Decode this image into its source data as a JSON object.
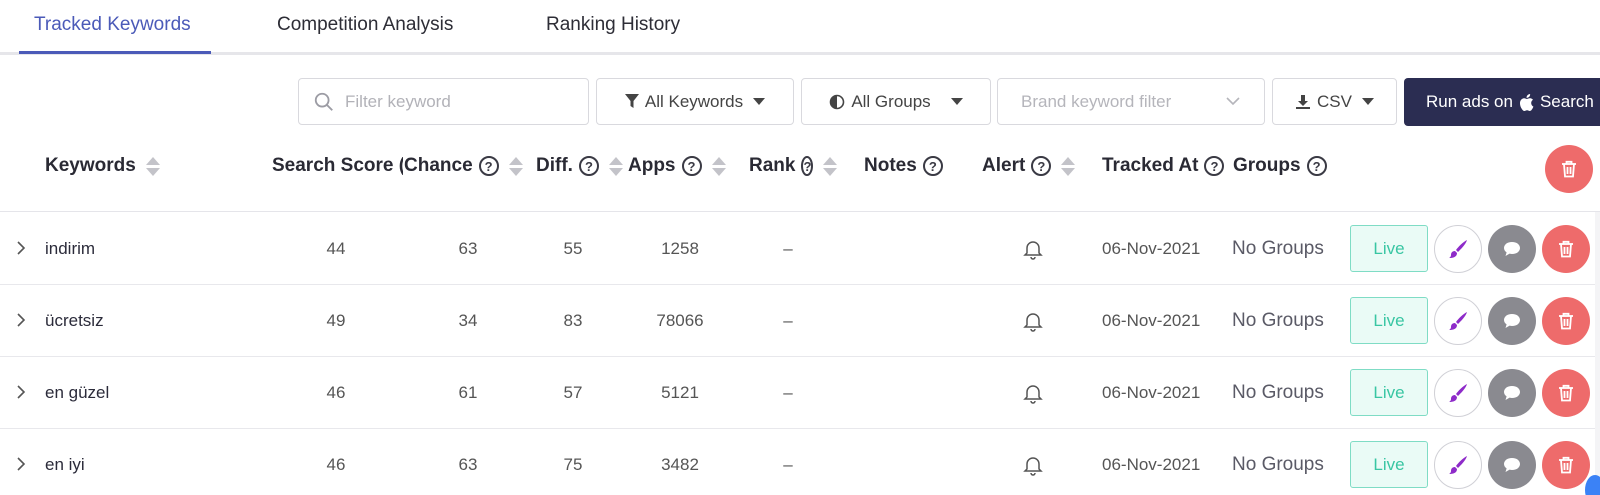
{
  "tabs": [
    {
      "label": "Tracked Keywords",
      "active": true
    },
    {
      "label": "Competition Analysis",
      "active": false
    },
    {
      "label": "Ranking History",
      "active": false
    }
  ],
  "toolbar": {
    "filter_placeholder": "Filter keyword",
    "keywords_filter": "All Keywords",
    "groups_filter": "All Groups",
    "brand_filter_placeholder": "Brand keyword filter",
    "export_label": "CSV",
    "ads_button_label": "Run ads on",
    "ads_button_suffix": "Search"
  },
  "columns": {
    "keywords": "Keywords",
    "search_score": "Search Score (",
    "chance": "Chance",
    "diff": "Diff.",
    "apps": "Apps",
    "rank": "Rank",
    "notes": "Notes",
    "alert": "Alert",
    "tracked_at": "Tracked At",
    "groups": "Groups"
  },
  "rows": [
    {
      "keyword": "indirim",
      "search_score": "44",
      "chance": "63",
      "diff": "55",
      "apps": "1258",
      "rank": "–",
      "tracked_at": "06-Nov-2021",
      "groups": "No Groups",
      "status": "Live"
    },
    {
      "keyword": "ücretsiz",
      "search_score": "49",
      "chance": "34",
      "diff": "83",
      "apps": "78066",
      "rank": "–",
      "tracked_at": "06-Nov-2021",
      "groups": "No Groups",
      "status": "Live"
    },
    {
      "keyword": "en güzel",
      "search_score": "46",
      "chance": "61",
      "diff": "57",
      "apps": "5121",
      "rank": "–",
      "tracked_at": "06-Nov-2021",
      "groups": "No Groups",
      "status": "Live"
    },
    {
      "keyword": "en iyi",
      "search_score": "46",
      "chance": "63",
      "diff": "75",
      "apps": "3482",
      "rank": "–",
      "tracked_at": "06-Nov-2021",
      "groups": "No Groups",
      "status": "Live"
    }
  ],
  "icons": {
    "search": "search-icon",
    "filter": "funnel-icon",
    "groups": "half-circle-icon",
    "download": "download-icon",
    "apple": "apple-icon",
    "expand": "chevron-right-icon",
    "alert": "bell-icon",
    "theme": "paint-brush-icon",
    "note": "speech-bubble-icon",
    "delete": "trash-icon"
  },
  "colors": {
    "accent": "#4b5ab8",
    "ads_button": "#2b2d52",
    "live_text": "#39c6a3",
    "live_bg": "#eafbf6",
    "delete": "#ee6b6b",
    "note": "#8a8a90",
    "brush": "#8e2bc9"
  }
}
